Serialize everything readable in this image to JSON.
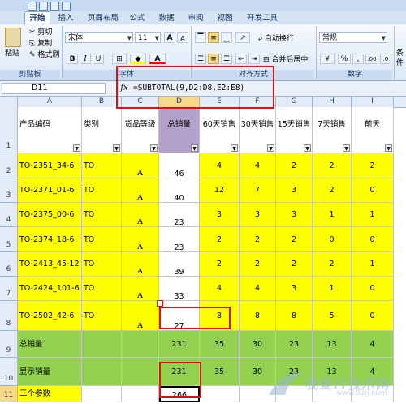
{
  "tabs": [
    "开始",
    "插入",
    "页面布局",
    "公式",
    "数据",
    "审阅",
    "视图",
    "开发工具"
  ],
  "active_tab": "开始",
  "ribbon": {
    "clipboard": {
      "paste": "粘贴",
      "cut": "剪切",
      "copy": "复制",
      "format_painter": "格式刷",
      "label": "剪贴板"
    },
    "font": {
      "name": "宋体",
      "size": "11",
      "grow": "A",
      "shrink": "A",
      "bold": "B",
      "italic": "I",
      "underline": "U",
      "label": "字体"
    },
    "alignment": {
      "wrap": "自动换行",
      "merge": "合并后居中",
      "label": "对齐方式"
    },
    "number": {
      "format": "常规",
      "currency": "¥",
      "percent": "%",
      "comma": ",",
      "inc_decimal": ".00",
      "dec_decimal": ".0",
      "label": "数字"
    },
    "styles": {
      "conditional": "条件"
    }
  },
  "formula_bar": {
    "cell_ref": "D11",
    "fx": "fx",
    "formula": "=SUBTOTAL(9,D2:D8,E2:E8)"
  },
  "columns": [
    "A",
    "B",
    "C",
    "D",
    "E",
    "F",
    "G",
    "H",
    "I"
  ],
  "row_numbers": [
    "1",
    "2",
    "3",
    "4",
    "5",
    "6",
    "7",
    "8",
    "9",
    "10",
    "11"
  ],
  "headers": [
    "产品编码",
    "类别",
    "货品等级",
    "总销量",
    "60天销售",
    "30天销售",
    "15天销售",
    "7天销售",
    "前天"
  ],
  "rows": [
    {
      "code": "TO-2351_34-6",
      "type": "TO",
      "grade": "A",
      "total": "46",
      "d60": "4",
      "d30": "4",
      "d15": "2",
      "d7": "2",
      "prev": "2"
    },
    {
      "code": "TO-2371_01-6",
      "type": "TO",
      "grade": "A",
      "total": "40",
      "d60": "12",
      "d30": "7",
      "d15": "3",
      "d7": "2",
      "prev": "0"
    },
    {
      "code": "TO-2375_00-6",
      "type": "TO",
      "grade": "A",
      "total": "23",
      "d60": "3",
      "d30": "3",
      "d15": "3",
      "d7": "1",
      "prev": "1"
    },
    {
      "code": "TO-2374_18-6",
      "type": "TO",
      "grade": "A",
      "total": "23",
      "d60": "2",
      "d30": "2",
      "d15": "2",
      "d7": "0",
      "prev": "0"
    },
    {
      "code": "TO-2413_45-12",
      "type": "TO",
      "grade": "A",
      "total": "39",
      "d60": "2",
      "d30": "2",
      "d15": "2",
      "d7": "2",
      "prev": "1"
    },
    {
      "code": "TO-2424_101-6",
      "type": "TO",
      "grade": "A",
      "total": "33",
      "d60": "4",
      "d30": "4",
      "d15": "3",
      "d7": "1",
      "prev": "0"
    },
    {
      "code": "TO-2502_42-6",
      "type": "TO",
      "grade": "A",
      "total": "27",
      "d60": "8",
      "d30": "8",
      "d15": "8",
      "d7": "5",
      "prev": "0"
    }
  ],
  "summary": {
    "total_label": "总销量",
    "total_values": [
      "231",
      "35",
      "30",
      "23",
      "13",
      "4"
    ],
    "shown_label": "显示销量",
    "shown_values": [
      "231",
      "35",
      "30",
      "23",
      "13",
      "4"
    ],
    "params_label": "三个参数",
    "params_value": "266"
  },
  "watermark": {
    "text": "我爱IT技术网",
    "url": "www.52ij.com"
  },
  "colors": {
    "yellow": "#ffff00",
    "green": "#92d050",
    "purple": "#b1a0c7",
    "highlight": "#dd1111"
  }
}
